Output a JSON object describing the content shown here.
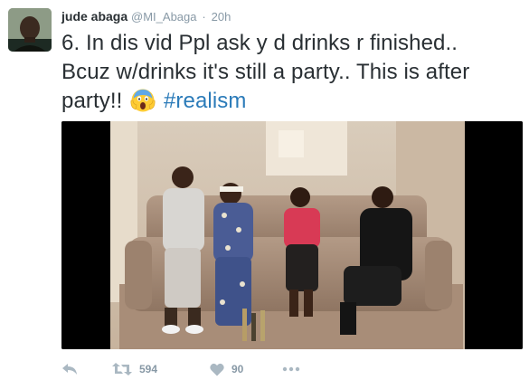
{
  "tweet": {
    "author_name": "jude abaga",
    "author_handle": "@MI_Abaga",
    "separator": "·",
    "timestamp": "20h",
    "text_line1": "6. In dis vid Ppl ask y d drinks r finished..",
    "text_line2": "Bcuz w/drinks it's still a party.. This is after",
    "text_line3_prefix": "party!! ",
    "hashtag": "#realism",
    "emoji": "screaming-face-emoji",
    "media": {
      "type": "video-still"
    }
  },
  "actions": {
    "reply_icon": "reply-icon",
    "retweet_icon": "retweet-icon",
    "retweet_count": "594",
    "like_icon": "heart-icon",
    "like_count": "90",
    "more_icon": "more-dots-icon"
  },
  "colors": {
    "text": "#292f33",
    "muted": "#8899a6",
    "hashtag": "#2b7bb9",
    "icon": "#aab8c2"
  }
}
